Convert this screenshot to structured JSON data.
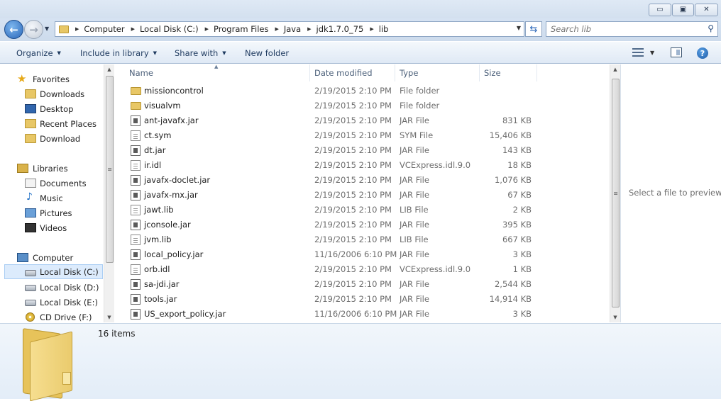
{
  "titlebar": {
    "minimize_icon": "minimize-icon",
    "maximize_icon": "maximize-icon",
    "close_icon": "close-icon"
  },
  "address": {
    "crumbs": [
      "Computer",
      "Local Disk (C:)",
      "Program Files",
      "Java",
      "jdk1.7.0_75",
      "lib"
    ]
  },
  "search": {
    "placeholder": "Search lib"
  },
  "toolbar": {
    "organize": "Organize",
    "include": "Include in library",
    "share": "Share with",
    "new_folder": "New folder"
  },
  "nav": {
    "favorites": "Favorites",
    "downloads": "Downloads",
    "desktop": "Desktop",
    "recent": "Recent Places",
    "download": "Download",
    "libraries": "Libraries",
    "documents": "Documents",
    "music": "Music",
    "pictures": "Pictures",
    "videos": "Videos",
    "computer": "Computer",
    "disk_c": "Local Disk (C:)",
    "disk_d": "Local Disk (D:)",
    "disk_e": "Local Disk (E:)",
    "cd": "CD Drive (F:)"
  },
  "columns": {
    "name": "Name",
    "date": "Date modified",
    "type": "Type",
    "size": "Size"
  },
  "files": [
    {
      "name": "missioncontrol",
      "date": "2/19/2015 2:10 PM",
      "type": "File folder",
      "size": "",
      "icon": "folder"
    },
    {
      "name": "visualvm",
      "date": "2/19/2015 2:10 PM",
      "type": "File folder",
      "size": "",
      "icon": "folder"
    },
    {
      "name": "ant-javafx.jar",
      "date": "2/19/2015 2:10 PM",
      "type": "JAR File",
      "size": "831 KB",
      "icon": "jar"
    },
    {
      "name": "ct.sym",
      "date": "2/19/2015 2:10 PM",
      "type": "SYM File",
      "size": "15,406 KB",
      "icon": "file"
    },
    {
      "name": "dt.jar",
      "date": "2/19/2015 2:10 PM",
      "type": "JAR File",
      "size": "143 KB",
      "icon": "jar"
    },
    {
      "name": "ir.idl",
      "date": "2/19/2015 2:10 PM",
      "type": "VCExpress.idl.9.0",
      "size": "18 KB",
      "icon": "file"
    },
    {
      "name": "javafx-doclet.jar",
      "date": "2/19/2015 2:10 PM",
      "type": "JAR File",
      "size": "1,076 KB",
      "icon": "jar"
    },
    {
      "name": "javafx-mx.jar",
      "date": "2/19/2015 2:10 PM",
      "type": "JAR File",
      "size": "67 KB",
      "icon": "jar"
    },
    {
      "name": "jawt.lib",
      "date": "2/19/2015 2:10 PM",
      "type": "LIB File",
      "size": "2 KB",
      "icon": "file"
    },
    {
      "name": "jconsole.jar",
      "date": "2/19/2015 2:10 PM",
      "type": "JAR File",
      "size": "395 KB",
      "icon": "jar"
    },
    {
      "name": "jvm.lib",
      "date": "2/19/2015 2:10 PM",
      "type": "LIB File",
      "size": "667 KB",
      "icon": "file"
    },
    {
      "name": "local_policy.jar",
      "date": "11/16/2006 6:10 PM",
      "type": "JAR File",
      "size": "3 KB",
      "icon": "jar"
    },
    {
      "name": "orb.idl",
      "date": "2/19/2015 2:10 PM",
      "type": "VCExpress.idl.9.0",
      "size": "1 KB",
      "icon": "file"
    },
    {
      "name": "sa-jdi.jar",
      "date": "2/19/2015 2:10 PM",
      "type": "JAR File",
      "size": "2,544 KB",
      "icon": "jar"
    },
    {
      "name": "tools.jar",
      "date": "2/19/2015 2:10 PM",
      "type": "JAR File",
      "size": "14,914 KB",
      "icon": "jar"
    },
    {
      "name": "US_export_policy.jar",
      "date": "11/16/2006 6:10 PM",
      "type": "JAR File",
      "size": "3 KB",
      "icon": "jar"
    }
  ],
  "preview": {
    "message": "Select a file to preview."
  },
  "details": {
    "count": "16 items"
  }
}
